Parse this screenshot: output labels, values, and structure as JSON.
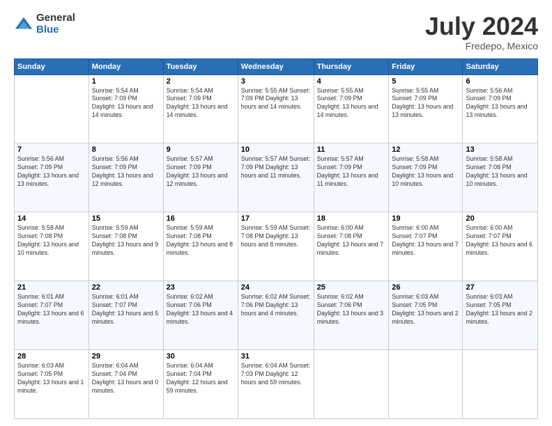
{
  "header": {
    "logo_general": "General",
    "logo_blue": "Blue",
    "title": "July 2024",
    "location": "Fredepo, Mexico"
  },
  "calendar": {
    "days_of_week": [
      "Sunday",
      "Monday",
      "Tuesday",
      "Wednesday",
      "Thursday",
      "Friday",
      "Saturday"
    ],
    "weeks": [
      [
        {
          "num": "",
          "info": ""
        },
        {
          "num": "1",
          "info": "Sunrise: 5:54 AM\nSunset: 7:09 PM\nDaylight: 13 hours\nand 14 minutes."
        },
        {
          "num": "2",
          "info": "Sunrise: 5:54 AM\nSunset: 7:09 PM\nDaylight: 13 hours\nand 14 minutes."
        },
        {
          "num": "3",
          "info": "Sunrise: 5:55 AM\nSunset: 7:09 PM\nDaylight: 13 hours\nand 14 minutes."
        },
        {
          "num": "4",
          "info": "Sunrise: 5:55 AM\nSunset: 7:09 PM\nDaylight: 13 hours\nand 14 minutes."
        },
        {
          "num": "5",
          "info": "Sunrise: 5:55 AM\nSunset: 7:09 PM\nDaylight: 13 hours\nand 13 minutes."
        },
        {
          "num": "6",
          "info": "Sunrise: 5:56 AM\nSunset: 7:09 PM\nDaylight: 13 hours\nand 13 minutes."
        }
      ],
      [
        {
          "num": "7",
          "info": "Sunrise: 5:56 AM\nSunset: 7:09 PM\nDaylight: 13 hours\nand 13 minutes."
        },
        {
          "num": "8",
          "info": "Sunrise: 5:56 AM\nSunset: 7:09 PM\nDaylight: 13 hours\nand 12 minutes."
        },
        {
          "num": "9",
          "info": "Sunrise: 5:57 AM\nSunset: 7:09 PM\nDaylight: 13 hours\nand 12 minutes."
        },
        {
          "num": "10",
          "info": "Sunrise: 5:57 AM\nSunset: 7:09 PM\nDaylight: 13 hours\nand 11 minutes."
        },
        {
          "num": "11",
          "info": "Sunrise: 5:57 AM\nSunset: 7:09 PM\nDaylight: 13 hours\nand 11 minutes."
        },
        {
          "num": "12",
          "info": "Sunrise: 5:58 AM\nSunset: 7:09 PM\nDaylight: 13 hours\nand 10 minutes."
        },
        {
          "num": "13",
          "info": "Sunrise: 5:58 AM\nSunset: 7:08 PM\nDaylight: 13 hours\nand 10 minutes."
        }
      ],
      [
        {
          "num": "14",
          "info": "Sunrise: 5:58 AM\nSunset: 7:08 PM\nDaylight: 13 hours\nand 10 minutes."
        },
        {
          "num": "15",
          "info": "Sunrise: 5:59 AM\nSunset: 7:08 PM\nDaylight: 13 hours\nand 9 minutes."
        },
        {
          "num": "16",
          "info": "Sunrise: 5:59 AM\nSunset: 7:08 PM\nDaylight: 13 hours\nand 8 minutes."
        },
        {
          "num": "17",
          "info": "Sunrise: 5:59 AM\nSunset: 7:08 PM\nDaylight: 13 hours\nand 8 minutes."
        },
        {
          "num": "18",
          "info": "Sunrise: 6:00 AM\nSunset: 7:08 PM\nDaylight: 13 hours\nand 7 minutes."
        },
        {
          "num": "19",
          "info": "Sunrise: 6:00 AM\nSunset: 7:07 PM\nDaylight: 13 hours\nand 7 minutes."
        },
        {
          "num": "20",
          "info": "Sunrise: 6:00 AM\nSunset: 7:07 PM\nDaylight: 13 hours\nand 6 minutes."
        }
      ],
      [
        {
          "num": "21",
          "info": "Sunrise: 6:01 AM\nSunset: 7:07 PM\nDaylight: 13 hours\nand 6 minutes."
        },
        {
          "num": "22",
          "info": "Sunrise: 6:01 AM\nSunset: 7:07 PM\nDaylight: 13 hours\nand 5 minutes."
        },
        {
          "num": "23",
          "info": "Sunrise: 6:02 AM\nSunset: 7:06 PM\nDaylight: 13 hours\nand 4 minutes."
        },
        {
          "num": "24",
          "info": "Sunrise: 6:02 AM\nSunset: 7:06 PM\nDaylight: 13 hours\nand 4 minutes."
        },
        {
          "num": "25",
          "info": "Sunrise: 6:02 AM\nSunset: 7:06 PM\nDaylight: 13 hours\nand 3 minutes."
        },
        {
          "num": "26",
          "info": "Sunrise: 6:03 AM\nSunset: 7:05 PM\nDaylight: 13 hours\nand 2 minutes."
        },
        {
          "num": "27",
          "info": "Sunrise: 6:03 AM\nSunset: 7:05 PM\nDaylight: 13 hours\nand 2 minutes."
        }
      ],
      [
        {
          "num": "28",
          "info": "Sunrise: 6:03 AM\nSunset: 7:05 PM\nDaylight: 13 hours\nand 1 minute."
        },
        {
          "num": "29",
          "info": "Sunrise: 6:04 AM\nSunset: 7:04 PM\nDaylight: 13 hours\nand 0 minutes."
        },
        {
          "num": "30",
          "info": "Sunrise: 6:04 AM\nSunset: 7:04 PM\nDaylight: 12 hours\nand 59 minutes."
        },
        {
          "num": "31",
          "info": "Sunrise: 6:04 AM\nSunset: 7:03 PM\nDaylight: 12 hours\nand 59 minutes."
        },
        {
          "num": "",
          "info": ""
        },
        {
          "num": "",
          "info": ""
        },
        {
          "num": "",
          "info": ""
        }
      ]
    ]
  }
}
